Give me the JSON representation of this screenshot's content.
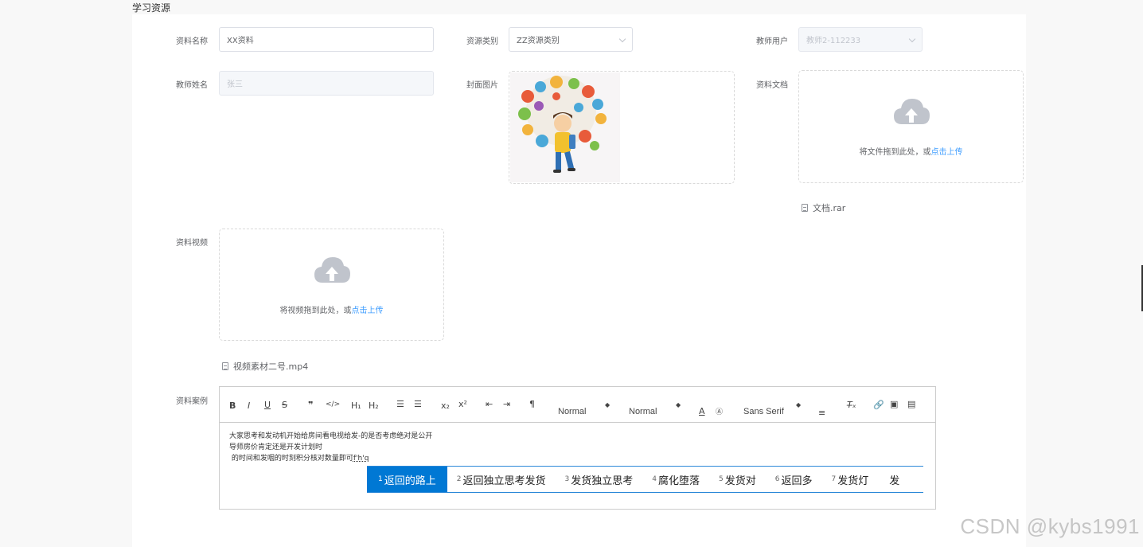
{
  "page_title": "学习资源",
  "form": {
    "name": {
      "label": "资料名称",
      "value": "XX资料"
    },
    "category": {
      "label": "资源类别",
      "value": "ZZ资源类别"
    },
    "teacher_account": {
      "label": "教师用户",
      "value": "教师2-112233"
    },
    "teacher_name": {
      "label": "教师姓名",
      "value": "张三"
    },
    "cover": {
      "label": "封面图片"
    },
    "document": {
      "label": "资料文档",
      "hint_prefix": "将文件拖到此处，或",
      "hint_link": "点击上传",
      "file": "文档.rar"
    },
    "video": {
      "label": "资料视频",
      "hint_prefix": "将视频拖到此处，或",
      "hint_link": "点击上传",
      "file": "视频素材二号.mp4"
    },
    "case": {
      "label": "资料案例",
      "toolbar": {
        "header_select": "Normal",
        "size_select": "Normal",
        "font_select": "Sans Serif"
      },
      "content": [
        "大家思考和发动机开始给房间看电视给发-的是否考虑绝对是公开",
        "导师房价肯定还是开发计划时",
        " 的时间和发咽的时刻积分核对数量即可"
      ],
      "ime_composition": "f'h'q"
    }
  },
  "ime": {
    "candidates": [
      {
        "num": "1",
        "text": "返回的路上",
        "selected": true
      },
      {
        "num": "2",
        "text": "返回独立思考发货"
      },
      {
        "num": "3",
        "text": "发货独立思考"
      },
      {
        "num": "4",
        "text": "腐化堕落"
      },
      {
        "num": "5",
        "text": "发货对"
      },
      {
        "num": "6",
        "text": "返回多"
      },
      {
        "num": "7",
        "text": "发货灯"
      },
      {
        "num": "",
        "text": "发"
      }
    ]
  },
  "watermark": "CSDN @kybs1991",
  "colors": {
    "link": "#409eff",
    "ime_selected": "#0078d4",
    "border": "#dcdfe6"
  }
}
